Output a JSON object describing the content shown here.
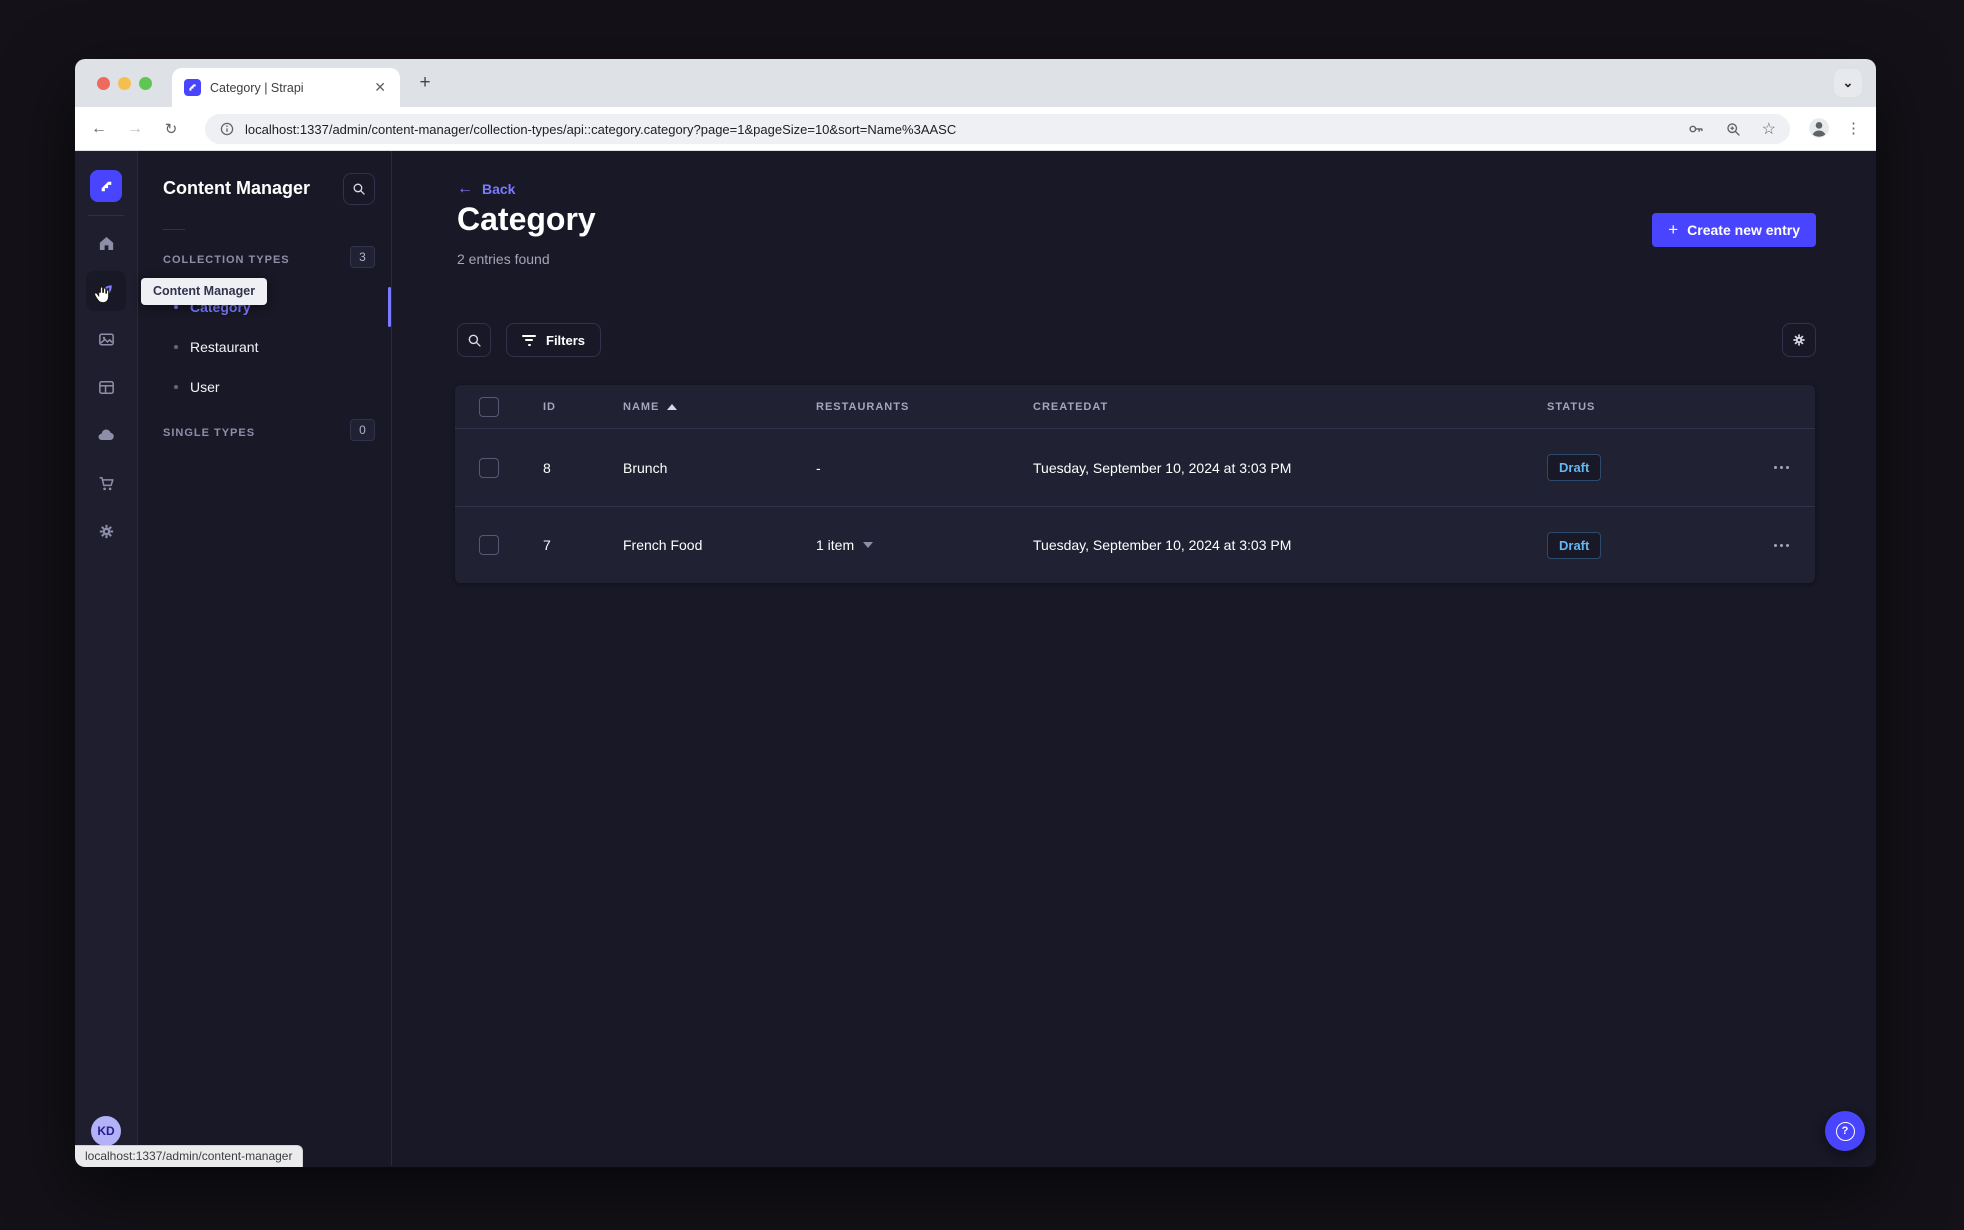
{
  "browser": {
    "tab_title": "Category | Strapi",
    "url": "localhost:1337/admin/content-manager/collection-types/api::category.category?page=1&pageSize=10&sort=Name%3AASC",
    "status_bar_text": "localhost:1337/admin/content-manager"
  },
  "glyphs": {
    "close_tab": "✕",
    "new_tab": "+",
    "tab_overflow": "⌄",
    "back": "←",
    "forward": "→",
    "reload": "↻",
    "bookmark_star": "☆",
    "menu_dots": "⋮",
    "back_arrow": "←",
    "plus": "+",
    "question_mark": "?"
  },
  "nav": {
    "tooltip": "Content Manager",
    "icons": [
      "strapi-logo",
      "home",
      "content-manager",
      "media-library",
      "content-type-builder",
      "cloud",
      "marketplace",
      "settings"
    ],
    "active_icon": "content-manager",
    "avatar_initials": "KD"
  },
  "subnav": {
    "title": "Content Manager",
    "sections": [
      {
        "label": "COLLECTION TYPES",
        "count": "3",
        "items": [
          {
            "label": "Category",
            "active": true
          },
          {
            "label": "Restaurant",
            "active": false
          },
          {
            "label": "User",
            "active": false
          }
        ]
      },
      {
        "label": "SINGLE TYPES",
        "count": "0",
        "items": []
      }
    ]
  },
  "main": {
    "back_label": "Back",
    "title": "Category",
    "entries_count": "2 entries found",
    "create_button_label": "Create new entry",
    "filters_button_label": "Filters",
    "table": {
      "columns": [
        "ID",
        "NAME",
        "RESTAURANTS",
        "CREATEDAT",
        "STATUS"
      ],
      "sort": {
        "column": "NAME",
        "direction": "asc"
      },
      "rows": [
        {
          "id": "8",
          "name": "Brunch",
          "restaurants": "-",
          "created_at": "Tuesday, September 10, 2024 at 3:03 PM",
          "status": "Draft"
        },
        {
          "id": "7",
          "name": "French Food",
          "restaurants": "1 item",
          "created_at": "Tuesday, September 10, 2024 at 3:03 PM",
          "status": "Draft"
        }
      ]
    }
  },
  "colors": {
    "primary": "#4945ff",
    "primary_light": "#7b79ff",
    "draft_status": "#66b7f1",
    "page_background": "#181826",
    "card_background": "#212134"
  }
}
